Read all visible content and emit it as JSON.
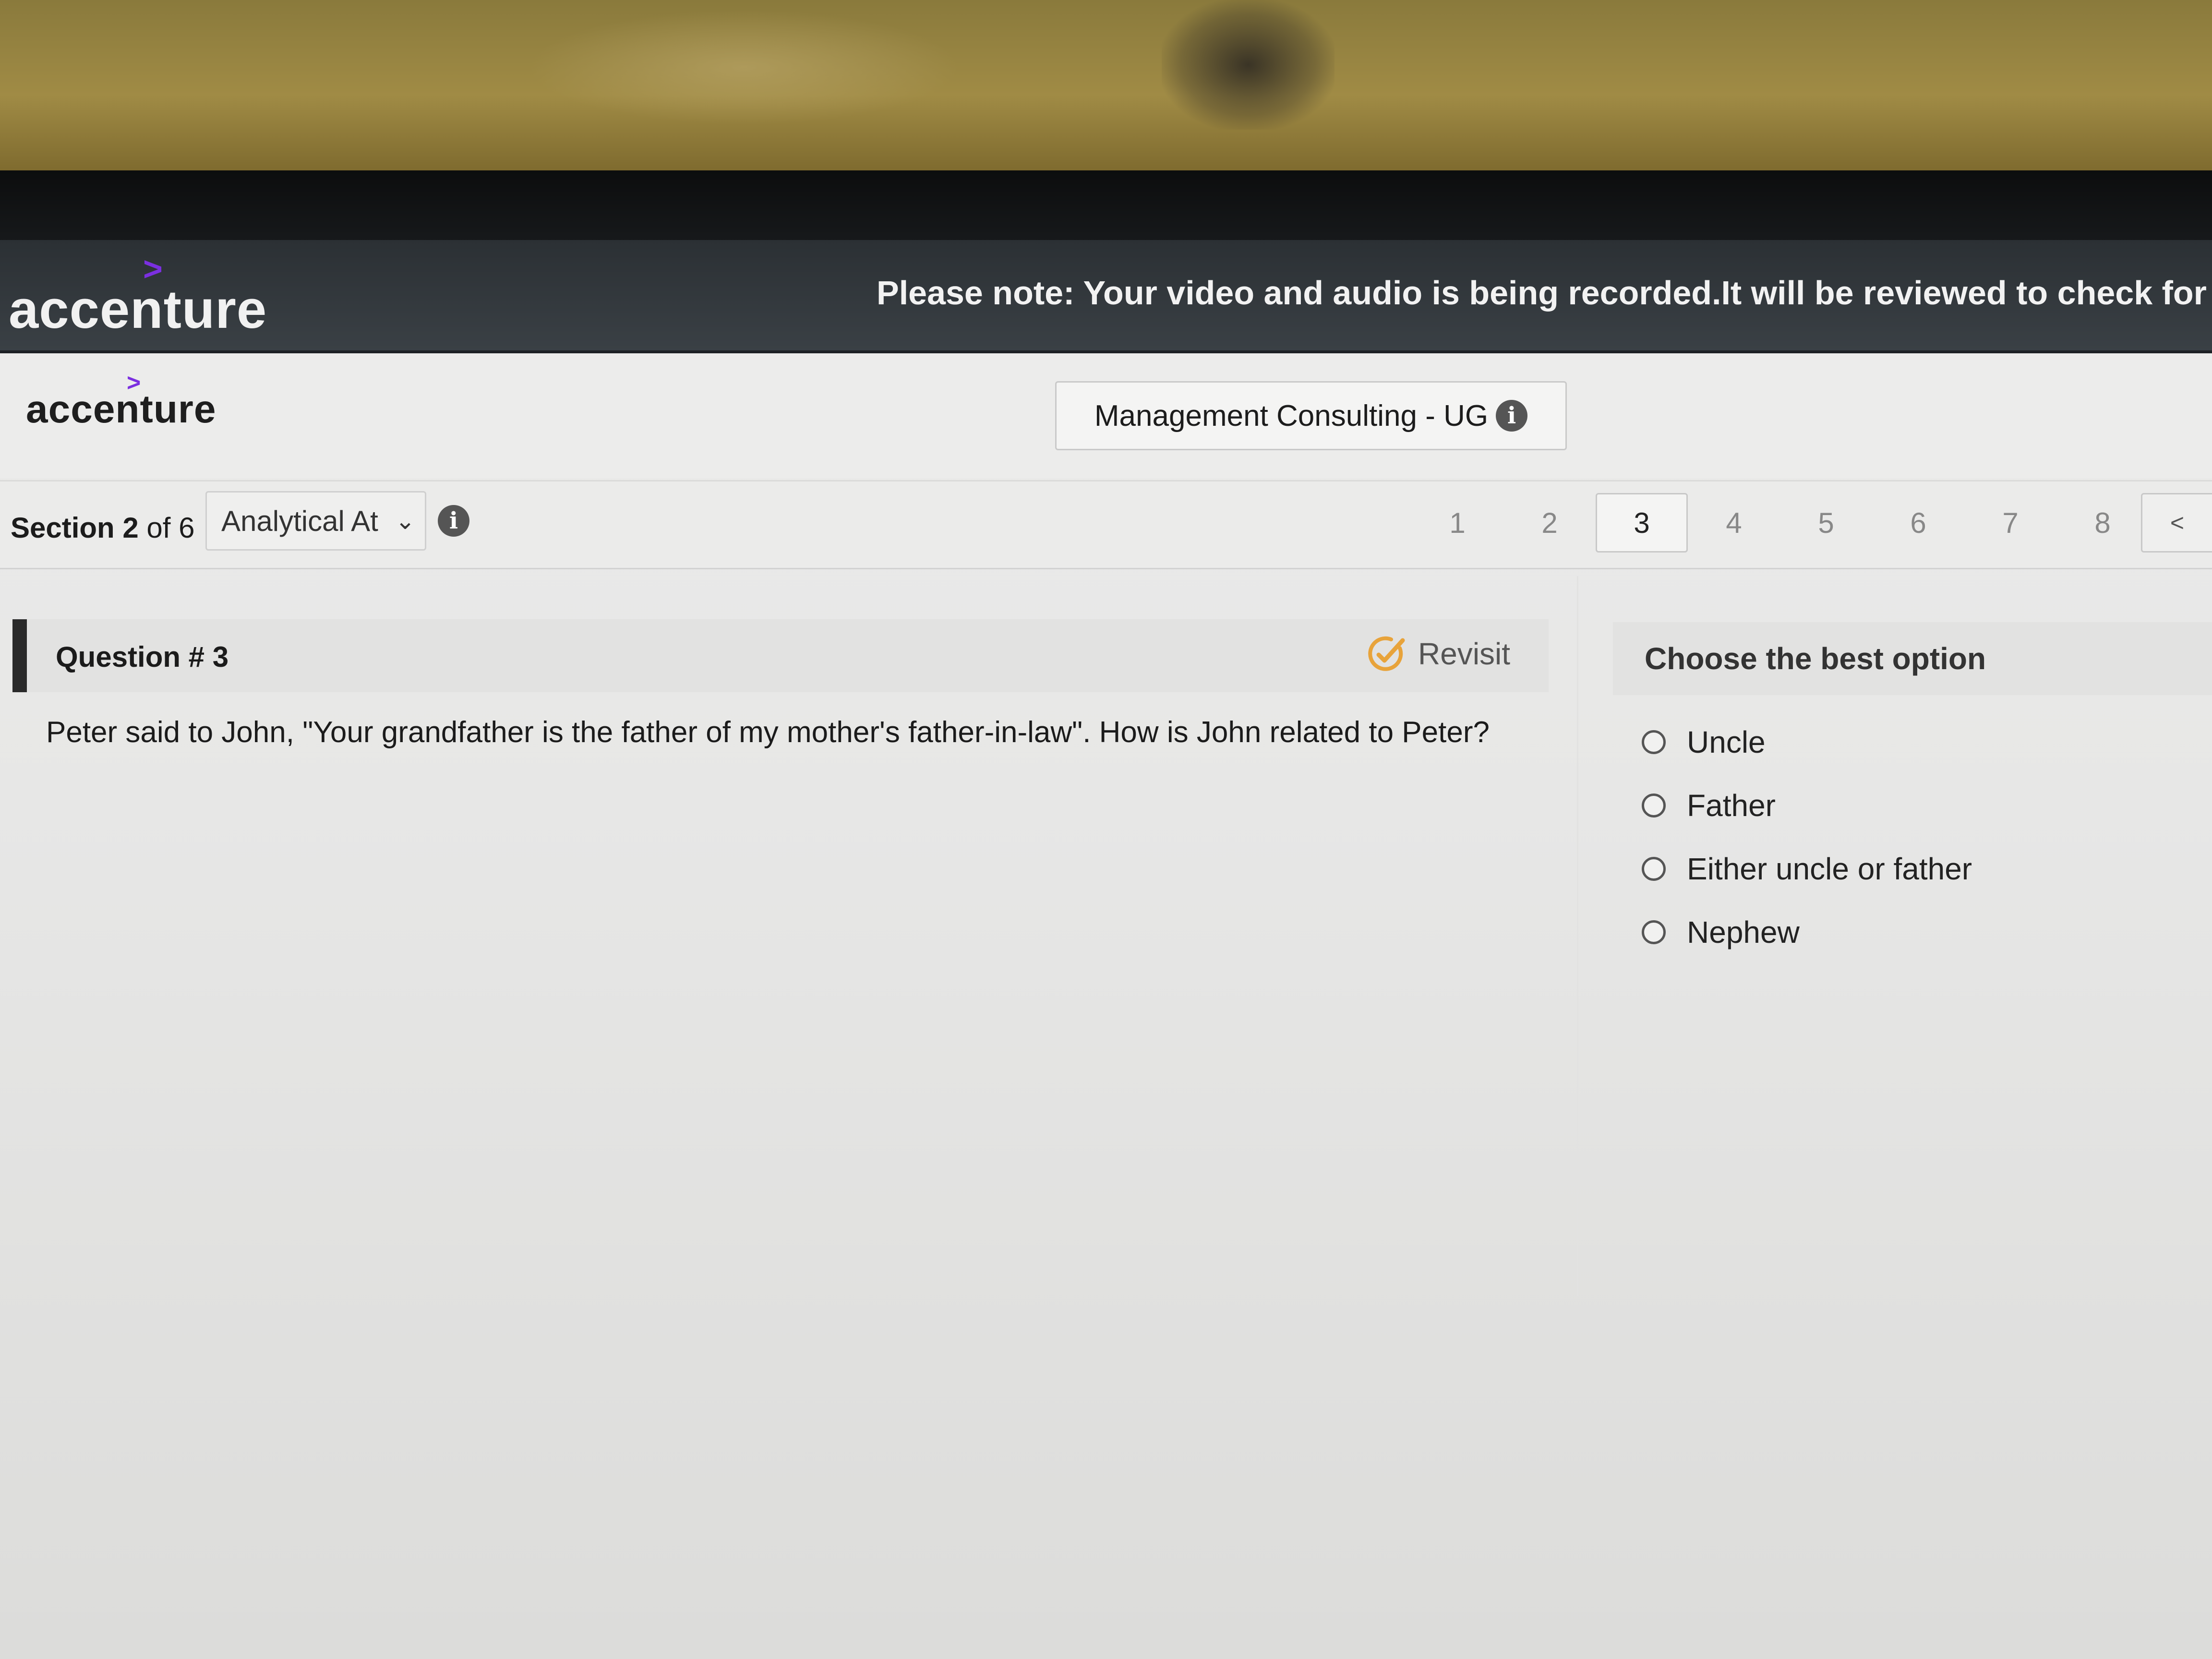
{
  "banner": {
    "brand": "accenture",
    "notice": "Please note: Your video and audio is being recorded.It will be reviewed to check for inte"
  },
  "header": {
    "brand": "accenture",
    "test_title": "Management Consulting - UG"
  },
  "section": {
    "label_bold": "Section 2",
    "label_rest": " of 6",
    "selected": "Analytical At"
  },
  "question_nav": {
    "items": [
      "1",
      "2",
      "3",
      "4",
      "5",
      "6",
      "7",
      "8"
    ],
    "current": "3",
    "prev": "<"
  },
  "question": {
    "title": "Question # 3",
    "revisit_label": "Revisit",
    "text": "Peter said to John, \"Your grandfather is the father of my mother's father-in-law\".  How is John related to Peter?"
  },
  "answers": {
    "header": "Choose the best option",
    "options": [
      "Uncle",
      "Father",
      "Either uncle or father",
      "Nephew"
    ]
  },
  "colors": {
    "banner_bg": "#2b3034",
    "brand_accent": "#7b2fe0",
    "revisit_icon": "#e8a33a",
    "question_marker": "#2a2a2a"
  },
  "icons": {
    "info": "info-icon",
    "dropdown": "chevron-down-icon",
    "revisit": "revisit-check-icon",
    "prev": "chevron-left-icon"
  }
}
